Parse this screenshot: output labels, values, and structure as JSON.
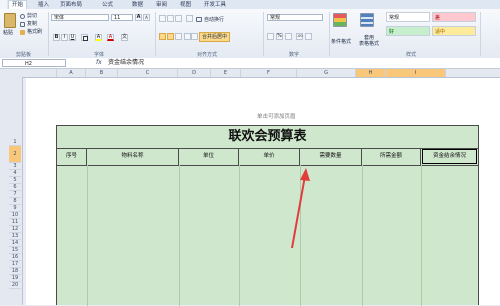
{
  "tabs": [
    "开始",
    "插入",
    "页面布局",
    "公式",
    "数据",
    "审阅",
    "视图",
    "开发工具"
  ],
  "clipboard": {
    "paste": "粘贴",
    "cut": "剪切",
    "copy": "复制",
    "format_painter": "格式刷",
    "group": "剪贴板"
  },
  "font": {
    "name": "宋体",
    "size": "11",
    "group": "字体",
    "bold": "B",
    "italic": "I",
    "underline": "U",
    "grow": "A",
    "shrink": "A",
    "color": "A",
    "fill": "A",
    "wen": "文"
  },
  "alignment": {
    "wrap": "自动换行",
    "merge": "合并后居中",
    "group": "对齐方式"
  },
  "number": {
    "format": "常规",
    "currency": "%",
    "group": "数字",
    "decimals": ".00"
  },
  "styles": {
    "cond_format": "条件格式",
    "as_table": "套用\n表格格式",
    "group": "样式",
    "cells": [
      {
        "label": "常规",
        "bg": "#ffffff",
        "color": "#222222"
      },
      {
        "label": "差",
        "bg": "#ffc7ce",
        "color": "#9c0006"
      },
      {
        "label": "好",
        "bg": "#c6efce",
        "color": "#006100"
      },
      {
        "label": "适中",
        "bg": "#ffeb9c",
        "color": "#9c6500"
      }
    ]
  },
  "formula_bar": {
    "name_box": "H2",
    "fx": "fx",
    "content": "资金结余情况"
  },
  "columns": [
    "A",
    "B",
    "C",
    "D",
    "E",
    "F",
    "G",
    "H",
    "I"
  ],
  "rows": [
    "1",
    "2",
    "3",
    "4",
    "5",
    "6",
    "7",
    "8",
    "9",
    "10",
    "11",
    "12",
    "13",
    "14",
    "15",
    "16",
    "17",
    "18",
    "19",
    "20"
  ],
  "page": {
    "header_hint": "单击可添加页眉"
  },
  "sheet": {
    "title": "联欢会预算表",
    "headers": [
      "序号",
      "物料名称",
      "单位",
      "单价",
      "需要数量",
      "所需金额",
      "资金结余情况"
    ]
  },
  "colors": {
    "sheet_fill": "#cfe7cd",
    "selected_header": "#f8c77a",
    "arrow": "#e23b3b"
  }
}
